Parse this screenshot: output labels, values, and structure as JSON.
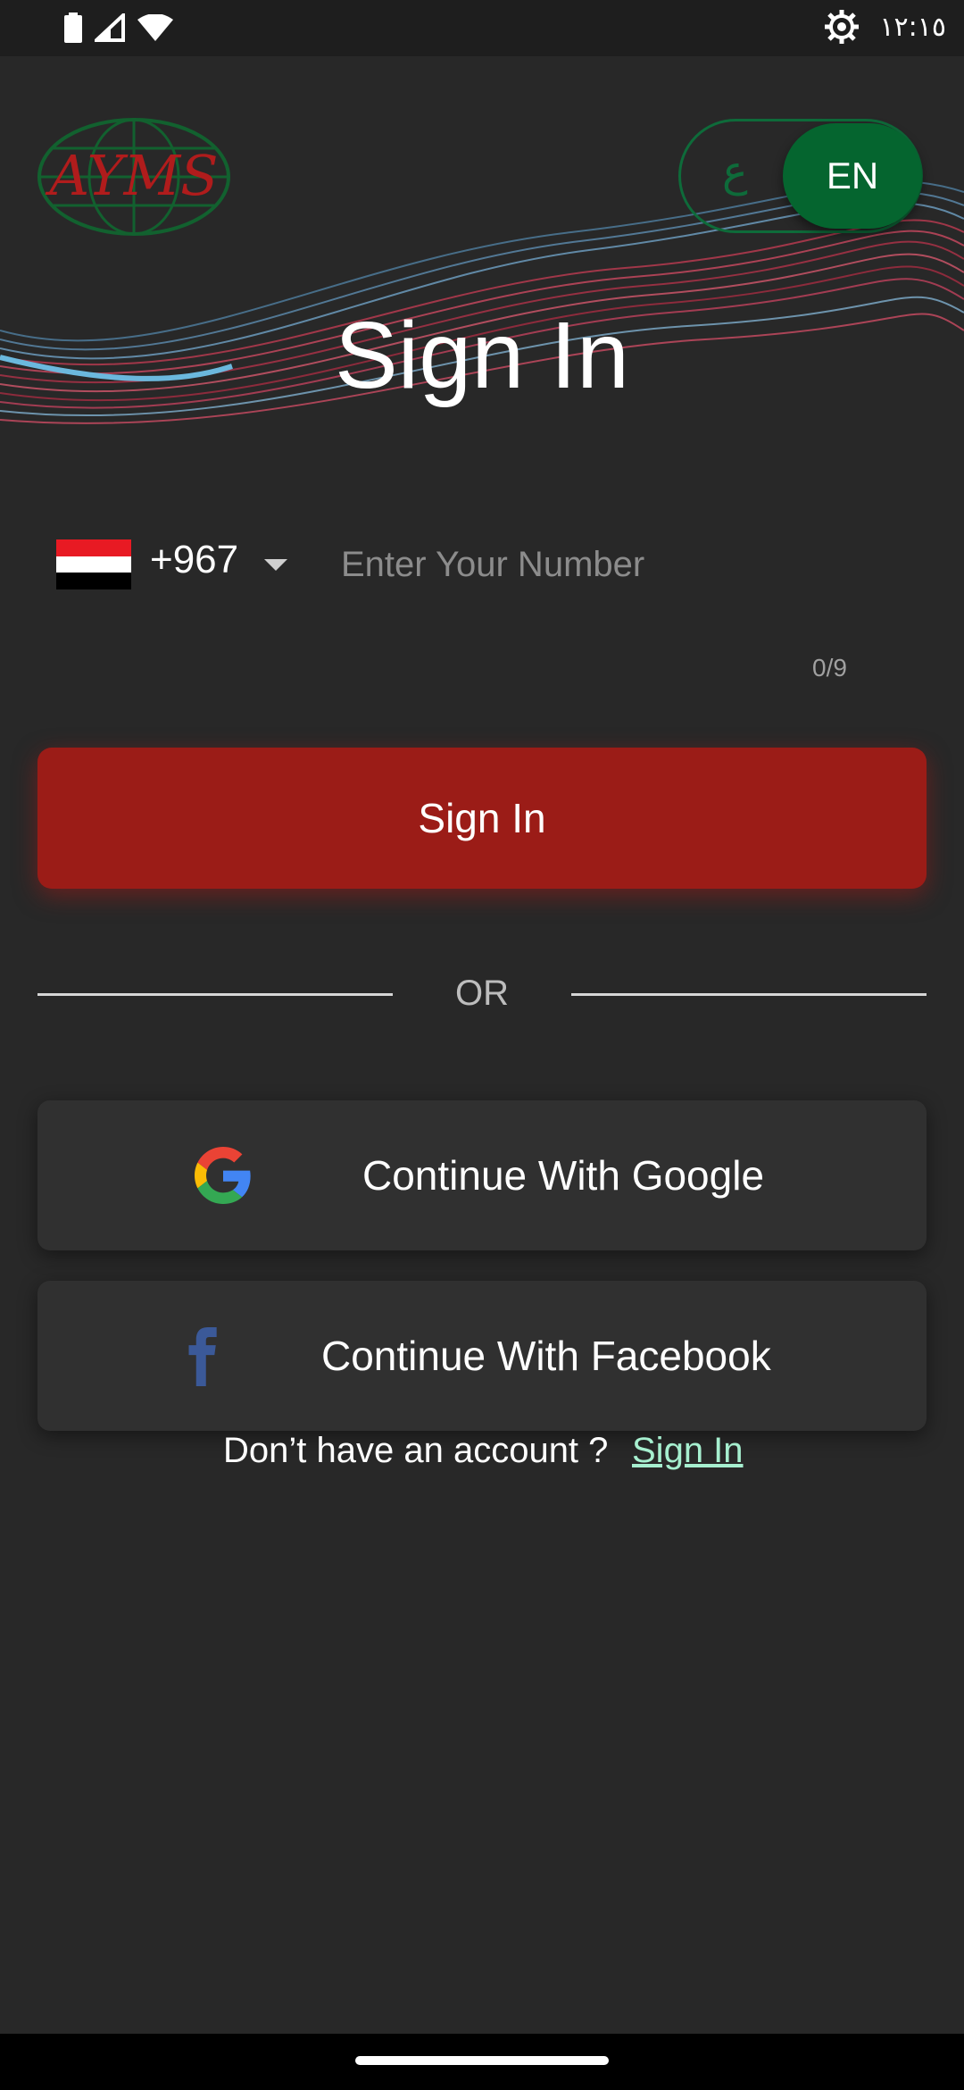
{
  "status_bar": {
    "time": "١٢:١٥",
    "icons": [
      "battery-icon",
      "signal-icon",
      "wifi-icon",
      "settings-icon"
    ]
  },
  "header": {
    "logo_text": "AYMS",
    "lang_toggle": {
      "inactive_label": "ع",
      "active_label": "EN"
    },
    "title": "Sign In"
  },
  "phone_input": {
    "flag": "yemen-flag",
    "dial_code": "+967",
    "placeholder": "Enter Your Number",
    "value": "",
    "counter": "0/9"
  },
  "primary_button": {
    "label": "Sign In"
  },
  "divider": {
    "label": "OR"
  },
  "social": {
    "google_label": "Continue With Google",
    "facebook_label": "Continue With Facebook"
  },
  "footer": {
    "prompt": "Don’t have an account ?",
    "link_label": "Sign In"
  },
  "colors": {
    "background": "#282828",
    "primary_red": "#9b1c17",
    "toggle_green": "#05652f",
    "link_green": "#a6efcf",
    "facebook_blue": "#3b5998"
  }
}
